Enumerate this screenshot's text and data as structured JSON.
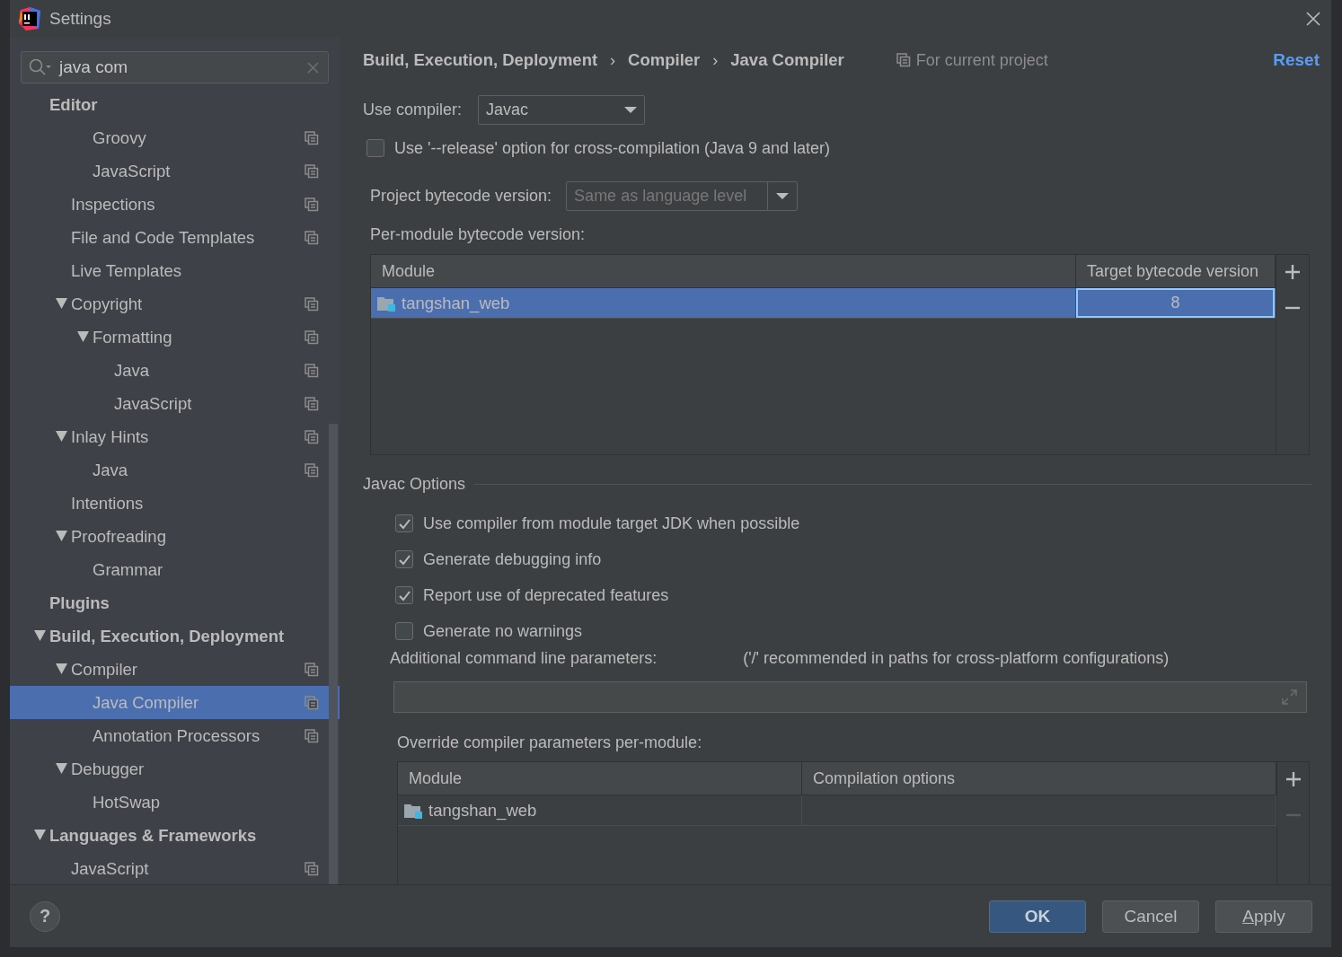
{
  "window": {
    "title": "Settings"
  },
  "search": {
    "value": "java com"
  },
  "sidebar": {
    "tree": [
      {
        "label": "Editor",
        "kind": "section",
        "children": [
          {
            "children": [
              {
                "label": "Groovy",
                "shared": true
              },
              {
                "label": "JavaScript",
                "shared": true
              }
            ]
          },
          {
            "label": "Inspections",
            "shared": true
          },
          {
            "label": "File and Code Templates",
            "shared": true
          },
          {
            "label": "Live Templates"
          },
          {
            "label": "Copyright",
            "shared": true,
            "expanded": true,
            "children": [
              {
                "label": "Formatting",
                "shared": true,
                "expanded": true,
                "children": [
                  {
                    "label": "Java",
                    "shared": true
                  },
                  {
                    "label": "JavaScript",
                    "shared": true
                  }
                ]
              }
            ]
          },
          {
            "label": "Inlay Hints",
            "shared": true,
            "expanded": true,
            "children": [
              {
                "label": "Java",
                "shared": true
              }
            ]
          },
          {
            "label": "Intentions"
          },
          {
            "label": "Proofreading",
            "expanded": true,
            "children": [
              {
                "label": "Grammar"
              }
            ]
          }
        ]
      },
      {
        "label": "Plugins",
        "kind": "section"
      },
      {
        "label": "Build, Execution, Deployment",
        "kind": "section",
        "expanded": true,
        "children": [
          {
            "label": "Compiler",
            "shared": true,
            "expanded": true,
            "children": [
              {
                "label": "Java Compiler",
                "shared": true,
                "selected": true
              },
              {
                "label": "Annotation Processors",
                "shared": true,
                "selected": false
              }
            ]
          },
          {
            "label": "Debugger",
            "expanded": true,
            "children": [
              {
                "label": "HotSwap"
              }
            ]
          }
        ]
      },
      {
        "label": "Languages & Frameworks",
        "kind": "section",
        "expanded": true,
        "children": [
          {
            "label": "JavaScript",
            "shared": true
          }
        ]
      }
    ]
  },
  "breadcrumb": [
    {
      "kind": "crumb",
      "text": "Build, Execution, Deployment"
    },
    {
      "kind": "separator",
      "text": "›"
    },
    {
      "kind": "crumb",
      "text": "Compiler"
    },
    {
      "kind": "separator",
      "text": "›"
    },
    {
      "kind": "crumb",
      "text": "Java Compiler"
    }
  ],
  "scope_note": "For current project",
  "reset_link": "Reset",
  "use_compiler": {
    "label": "Use compiler:",
    "value": "Javac"
  },
  "release_option": {
    "label": "Use '--release' option for cross-compilation (Java 9 and later)",
    "checked": false
  },
  "project_bytecode": {
    "label": "Project bytecode version:",
    "value": "Same as language level",
    "disabled": true
  },
  "per_module_label": "Per-module bytecode version:",
  "bytecode_table": {
    "columns": [
      "Module",
      "Target bytecode version"
    ],
    "rows": [
      {
        "module": "tangshan_web",
        "target": "8",
        "selected": true,
        "editing": true
      }
    ],
    "toolbar": [
      {
        "kind": "add",
        "disabled": false
      },
      {
        "kind": "remove",
        "disabled": false
      }
    ]
  },
  "javac_options": {
    "title": "Javac Options",
    "options": [
      {
        "label": "Use compiler from module target JDK when possible",
        "checked": true
      },
      {
        "label": "Generate debugging info",
        "checked": true
      },
      {
        "label": "Report use of deprecated features",
        "checked": true
      },
      {
        "label": "Generate no warnings",
        "checked": false
      }
    ]
  },
  "additional_params": {
    "label": "Additional command line parameters:",
    "hint": "('/' recommended in paths for cross-platform configurations)"
  },
  "override_label": "Override compiler parameters per-module:",
  "override_table": {
    "columns": [
      "Module",
      "Compilation options"
    ],
    "rows": [
      {
        "module": "tangshan_web",
        "selected": false
      }
    ],
    "toolbar": [
      {
        "kind": "add",
        "disabled": false
      },
      {
        "kind": "remove",
        "disabled": true
      }
    ]
  },
  "help_button": "?",
  "buttons": [
    {
      "label": "OK",
      "default": true
    },
    {
      "label": "Cancel",
      "default": false
    },
    {
      "label": "Apply",
      "default": false,
      "mnemonic": true
    }
  ]
}
